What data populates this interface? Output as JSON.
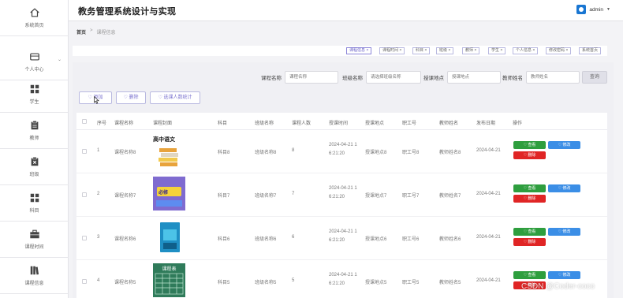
{
  "app": {
    "title": "教务管理系统设计与实现",
    "user": "admin"
  },
  "sidebar": [
    {
      "label": "系统首页",
      "icon": "home-icon"
    },
    {
      "label": "个人中心",
      "icon": "wallet-icon",
      "caret": "⌄"
    },
    {
      "label": "学生",
      "icon": "grid-icon"
    },
    {
      "label": "教师",
      "icon": "clipboard-icon"
    },
    {
      "label": "班级",
      "icon": "clipboard-x-icon"
    },
    {
      "label": "科目",
      "icon": "grid-icon"
    },
    {
      "label": "课程时间",
      "icon": "briefcase-icon"
    },
    {
      "label": "课程信息",
      "icon": "book-icon"
    }
  ],
  "breadcrumb": {
    "home": "首页",
    "sep": ">",
    "current": "课程信息"
  },
  "tags": [
    "课程信息 ×",
    "课程时间 ×",
    "科目 ×",
    "班级 ×",
    "教师 ×",
    "学生 ×",
    "个人信息 ×",
    "修改密码 ×",
    "系统首页"
  ],
  "search": {
    "course_label": "课程名称",
    "course_placeholder": "课程名称",
    "class_label": "班级名称",
    "class_placeholder": "请选择班级名称",
    "place_label": "授课地点",
    "place_placeholder": "授课地点",
    "teacher_label": "教师姓名",
    "teacher_placeholder": "教师姓名",
    "button": "查询"
  },
  "ops": {
    "add": "添加",
    "delete": "删除",
    "stats": "选课人数统计"
  },
  "table": {
    "headers": [
      "序号",
      "课程名称",
      "课程封面",
      "科目",
      "班级名称",
      "课程人数",
      "授课时间",
      "授课地点",
      "职工号",
      "教师姓名",
      "发布日期",
      "操作"
    ],
    "rows": [
      {
        "no": "1",
        "name": "课程名称8",
        "cover_text": "高中语文",
        "subject": "科目8",
        "class": "班级名称8",
        "count": "8",
        "time1": "2024-04-21 1",
        "time2": "6:21:20",
        "place": "授课地点8",
        "staff": "职工号8",
        "teacher": "教师姓名8",
        "date": "2024-04-21"
      },
      {
        "no": "2",
        "name": "课程名称7",
        "cover_text": "必修",
        "subject": "科目7",
        "class": "班级名称7",
        "count": "7",
        "time1": "2024-04-21 1",
        "time2": "6:21:20",
        "place": "授课地点7",
        "staff": "职工号7",
        "teacher": "教师姓名7",
        "date": "2024-04-21"
      },
      {
        "no": "3",
        "name": "课程名称6",
        "cover_text": "",
        "subject": "科目6",
        "class": "班级名称6",
        "count": "6",
        "time1": "2024-04-21 1",
        "time2": "6:21:20",
        "place": "授课地点6",
        "staff": "职工号6",
        "teacher": "教师姓名6",
        "date": "2024-04-21"
      },
      {
        "no": "4",
        "name": "课程名称5",
        "cover_text": "课程表",
        "subject": "科目5",
        "class": "班级名称5",
        "count": "5",
        "time1": "2024-04-21 1",
        "time2": "6:21:20",
        "place": "授课地点5",
        "staff": "职工号5",
        "teacher": "教师姓名5",
        "date": "2024-04-21"
      }
    ],
    "actions": {
      "view": "♡ 查看",
      "edit": "♡ 修改",
      "delete": "♡ 删除"
    }
  },
  "watermark": "CSDN @Coder-coco"
}
